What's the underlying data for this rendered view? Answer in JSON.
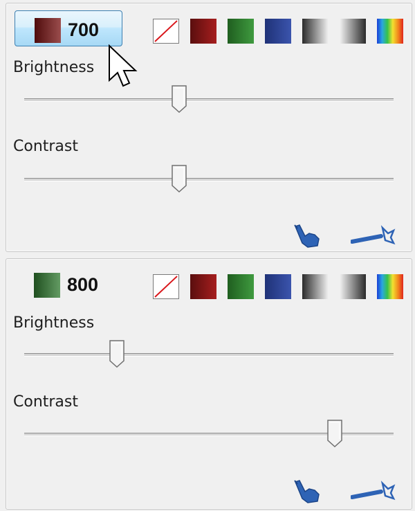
{
  "panels": [
    {
      "channel_value": "700",
      "channel_color": "#7a1212",
      "selected": true,
      "brightness_label": "Brightness",
      "brightness_level_percent": 42,
      "contrast_label": "Contrast",
      "contrast_level_percent": 42
    },
    {
      "channel_value": "800",
      "channel_color": "#2f7a2f",
      "selected": false,
      "brightness_label": "Brightness",
      "brightness_level_percent": 25,
      "contrast_label": "Contrast",
      "contrast_level_percent": 84
    }
  ],
  "colormaps": [
    {
      "name": "none",
      "icon": "no-color-icon"
    },
    {
      "name": "red",
      "colors": [
        "#5a0e0e",
        "#a61e1e"
      ]
    },
    {
      "name": "green",
      "colors": [
        "#1f5e1f",
        "#3f9a3f"
      ]
    },
    {
      "name": "blue",
      "colors": [
        "#1f3277",
        "#3b54ad"
      ]
    },
    {
      "name": "gray",
      "colors": [
        "#2a2a2a",
        "#f2f2f2"
      ]
    },
    {
      "name": "gray-reverse",
      "colors": [
        "#f2f2f2",
        "#2a2a2a"
      ]
    },
    {
      "name": "spectrum",
      "colors": [
        "#1b3fd8",
        "#2aa7e0",
        "#37c24a",
        "#f2e030",
        "#f28a1e",
        "#e0261d"
      ]
    }
  ],
  "icons": {
    "pointer_tool": "pointer-hand-icon",
    "line_tool": "line-arrow-icon"
  }
}
